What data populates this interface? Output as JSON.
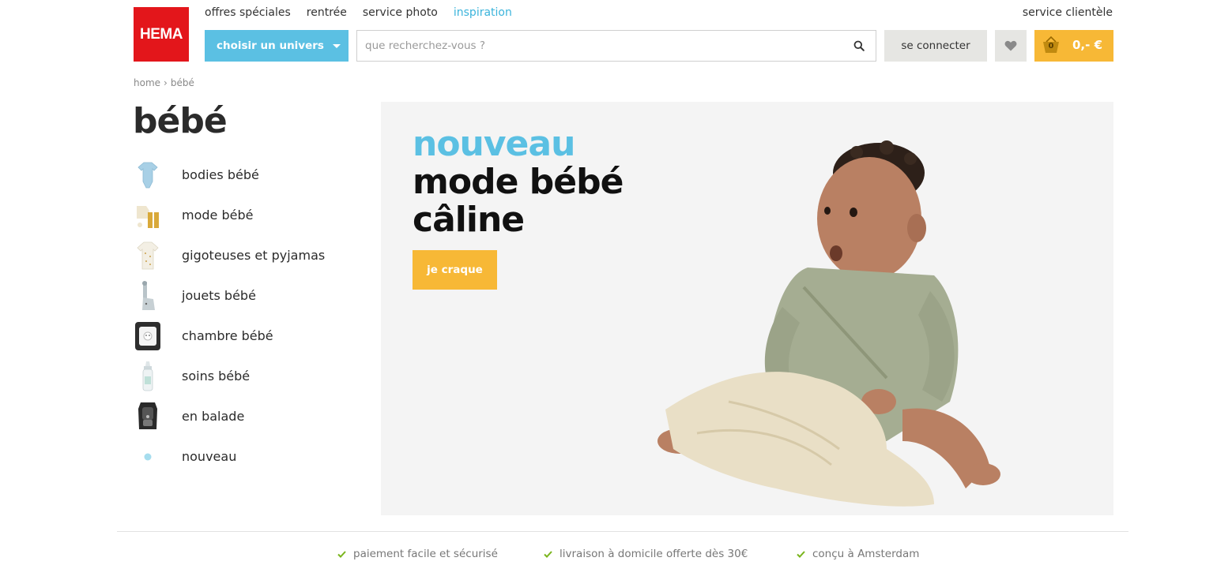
{
  "brand": {
    "logo_text": "HEMA",
    "logo_color": "#e3161b"
  },
  "topnav": {
    "items": [
      {
        "label": "offres spéciales"
      },
      {
        "label": "rentrée"
      },
      {
        "label": "service photo"
      },
      {
        "label": "inspiration"
      }
    ],
    "customer_service": "service clientèle"
  },
  "header": {
    "universe_button": "choisir un univers",
    "search_placeholder": "que recherchez-vous ?",
    "login_button": "se connecter",
    "cart": {
      "count": "0",
      "total": "0,- €"
    }
  },
  "breadcrumb": {
    "home": "home",
    "separator": "›",
    "current": "bébé"
  },
  "page": {
    "title": "bébé"
  },
  "side_menu": {
    "items": [
      {
        "label": "bodies bébé",
        "icon": "bodysuit-icon"
      },
      {
        "label": "mode bébé",
        "icon": "baby-outfit-icon"
      },
      {
        "label": "gigoteuses et pyjamas",
        "icon": "sleepsuit-icon"
      },
      {
        "label": "jouets bébé",
        "icon": "giraffe-toy-icon"
      },
      {
        "label": "chambre bébé",
        "icon": "baby-room-icon"
      },
      {
        "label": "soins bébé",
        "icon": "baby-bottle-icon"
      },
      {
        "label": "en balade",
        "icon": "car-seat-icon"
      },
      {
        "label": "nouveau",
        "icon": "dot-icon"
      }
    ]
  },
  "hero": {
    "line1": "nouveau",
    "line2": "mode bébé",
    "line3": "câline",
    "cta": "je craque"
  },
  "usps": [
    {
      "label": "paiement facile et sécurisé"
    },
    {
      "label": "livraison à domicile offerte dès 30€"
    },
    {
      "label": "conçu à Amsterdam"
    }
  ],
  "colors": {
    "accent_blue": "#5bc0e3",
    "accent_yellow": "#f7b836",
    "check_green": "#7ab51d"
  }
}
